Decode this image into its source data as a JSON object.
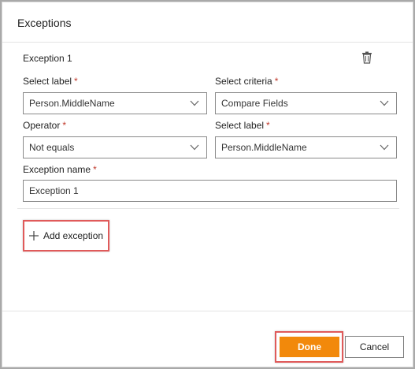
{
  "dialog": {
    "title": "Exceptions",
    "done_label": "Done",
    "cancel_label": "Cancel"
  },
  "exception": {
    "title": "Exception 1",
    "select_label_1": {
      "label": "Select label",
      "required_mark": "*",
      "value": "Person.MiddleName"
    },
    "select_criteria": {
      "label": "Select criteria",
      "required_mark": "*",
      "value": "Compare Fields"
    },
    "operator": {
      "label": "Operator",
      "required_mark": "*",
      "value": "Not equals"
    },
    "select_label_2": {
      "label": "Select label",
      "required_mark": "*",
      "value": "Person.MiddleName"
    },
    "exception_name": {
      "label": "Exception name",
      "required_mark": "*",
      "value": "Exception 1"
    }
  },
  "add_exception_label": "Add exception",
  "icons": {
    "delete": "trash-icon",
    "dropdown": "chevron-down-icon",
    "add": "plus-icon"
  },
  "colors": {
    "primary_button": "#f2890b",
    "required_mark": "#c0392b",
    "highlight": "#e05a5a"
  }
}
